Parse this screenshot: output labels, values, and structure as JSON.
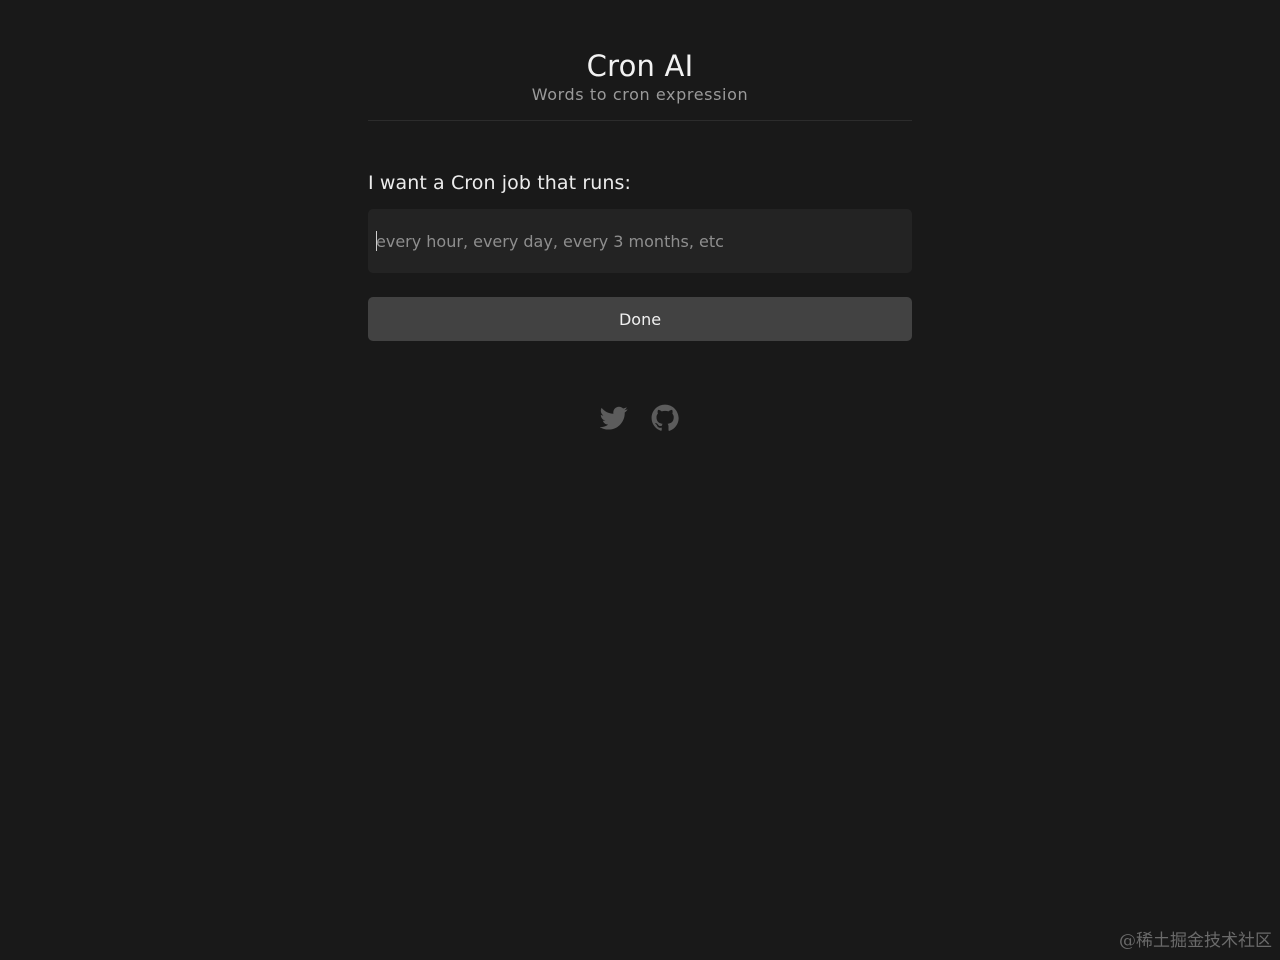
{
  "header": {
    "title": "Cron AI",
    "subtitle": "Words to cron expression"
  },
  "form": {
    "label": "I want a Cron job that runs:",
    "input": {
      "value": "",
      "placeholder": "every hour, every day, every 3 months, etc"
    },
    "done_label": "Done"
  },
  "footer": {
    "icons": [
      "twitter-icon",
      "github-icon"
    ]
  },
  "watermark": "@稀土掘金技术社区",
  "colors": {
    "background": "#191919",
    "input_background": "#232323",
    "button_background": "#424242",
    "icon": "#5c5c5c"
  }
}
